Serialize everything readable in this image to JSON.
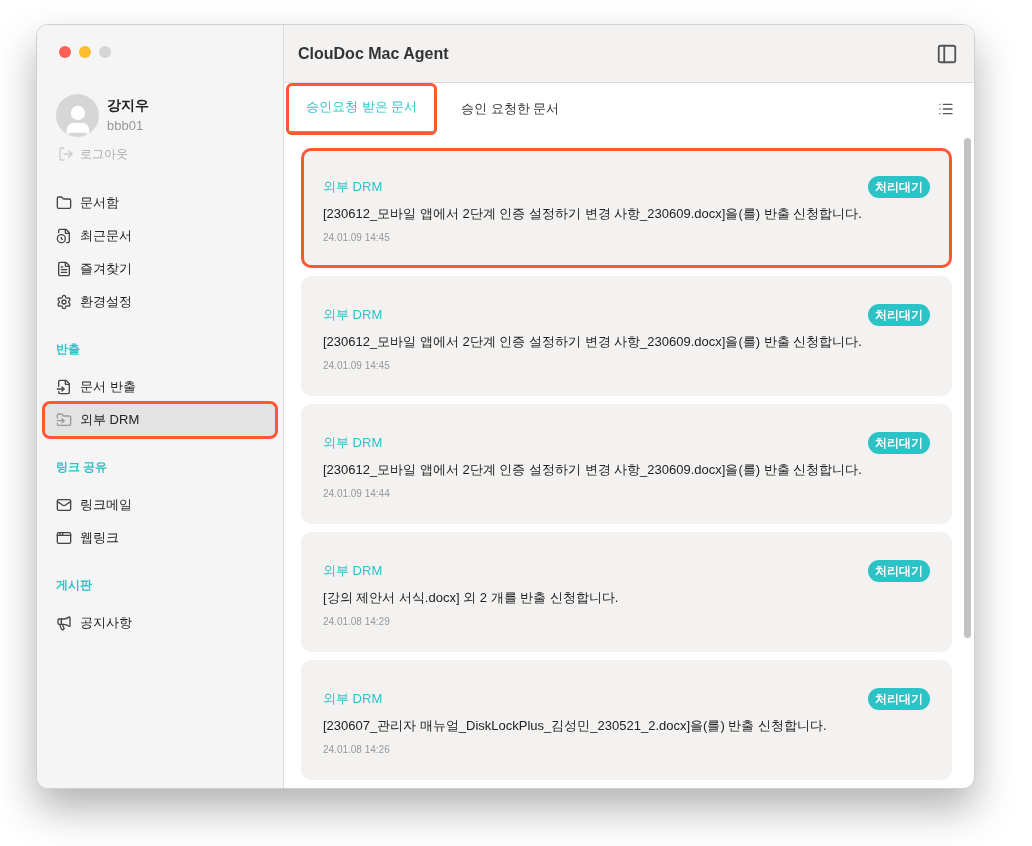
{
  "window": {
    "title": "ClouDoc Mac Agent"
  },
  "user": {
    "name": "강지우",
    "id": "bbb01",
    "logout": "로그아웃"
  },
  "sidebar": {
    "sections": [
      {
        "items": [
          {
            "label": "문서함",
            "selected": false,
            "highlighted": false
          },
          {
            "label": "최근문서",
            "selected": false,
            "highlighted": false
          },
          {
            "label": "즐겨찾기",
            "selected": false,
            "highlighted": false
          },
          {
            "label": "환경설정",
            "selected": false,
            "highlighted": false
          }
        ]
      },
      {
        "title": "반출",
        "items": [
          {
            "label": "문서 반출",
            "selected": false,
            "highlighted": false
          },
          {
            "label": "외부 DRM",
            "selected": true,
            "highlighted": true
          }
        ]
      },
      {
        "title": "링크 공유",
        "items": [
          {
            "label": "링크메일",
            "selected": false,
            "highlighted": false
          },
          {
            "label": "웹링크",
            "selected": false,
            "highlighted": false
          }
        ]
      },
      {
        "title": "게시판",
        "items": [
          {
            "label": "공지사항",
            "selected": false,
            "highlighted": false
          }
        ]
      }
    ]
  },
  "tabs": [
    {
      "label": "승인요청 받은 문서",
      "selected": true,
      "highlighted": true
    },
    {
      "label": "승인 요청한 문서",
      "selected": false,
      "highlighted": false
    }
  ],
  "requests": [
    {
      "category": "외부 DRM",
      "status": "처리대기",
      "message": "[230612_모바일 앱에서 2단계 인증 설정하기 변경 사항_230609.docx]을(를) 반출 신청합니다.",
      "time": "24.01.09 14:45",
      "highlighted": true
    },
    {
      "category": "외부 DRM",
      "status": "처리대기",
      "message": "[230612_모바일 앱에서 2단계 인증 설정하기 변경 사항_230609.docx]을(를) 반출 신청합니다.",
      "time": "24.01.09 14:45",
      "highlighted": false
    },
    {
      "category": "외부 DRM",
      "status": "처리대기",
      "message": "[230612_모바일 앱에서 2단계 인증 설정하기 변경 사항_230609.docx]을(를) 반출 신청합니다.",
      "time": "24.01.09 14:44",
      "highlighted": false
    },
    {
      "category": "외부 DRM",
      "status": "처리대기",
      "message": "[강의 제안서 서식.docx] 외 2 개를 반출 신청합니다.",
      "time": "24.01.08 14:29",
      "highlighted": false
    },
    {
      "category": "외부 DRM",
      "status": "처리대기",
      "message": "[230607_관리자 매뉴얼_DiskLockPlus_김성민_230521_2.docx]을(를) 반출 신청합니다.",
      "time": "24.01.08 14:26",
      "highlighted": false
    }
  ]
}
